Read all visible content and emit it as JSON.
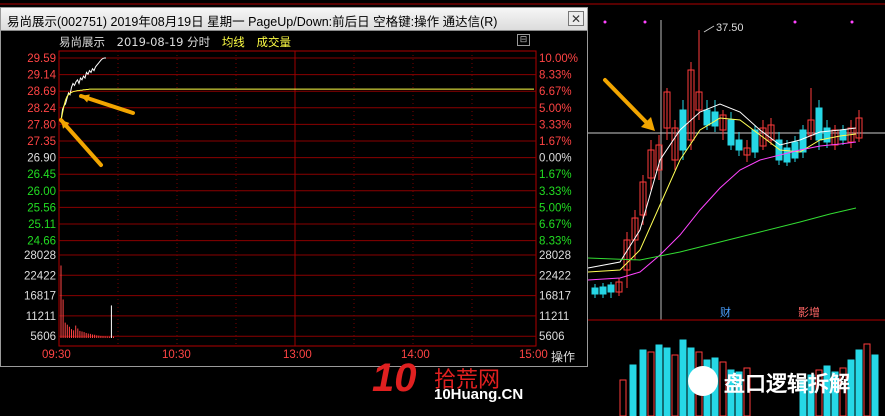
{
  "window": {
    "title": "易尚展示(002751)  2019年08月19日 星期一  PageUp/Down:前后日 空格键:操作  通达信(R)",
    "close_symbol": "✕",
    "minimize_symbol": "⊟"
  },
  "info_row": {
    "stock_name": "易尚展示",
    "date_label": "2019-08-19 分时",
    "avg_line_label": "均线",
    "volume_label": "成交量"
  },
  "price_axis": {
    "left": [
      "29.59",
      "29.14",
      "28.69",
      "28.24",
      "27.80",
      "27.35",
      "26.90",
      "26.45",
      "26.00",
      "25.56",
      "25.11",
      "24.66"
    ],
    "right": [
      "10.00%",
      "8.33%",
      "6.67%",
      "5.00%",
      "3.33%",
      "1.67%",
      "0.00%",
      "1.67%",
      "3.33%",
      "5.00%",
      "6.67%",
      "8.33%"
    ]
  },
  "volume_axis": {
    "left": [
      "28028",
      "22422",
      "16817",
      "11211",
      "5606"
    ],
    "right": [
      "28028",
      "22422",
      "16817",
      "11211",
      "5606"
    ]
  },
  "time_axis": [
    "09:30",
    "10:30",
    "13:00",
    "14:00",
    "15:00"
  ],
  "operate_button": "操作",
  "background_chart": {
    "high_label": "37.50",
    "badge_cai": "财",
    "badge_zeng": "影增",
    "colors": {
      "up": "#ff3b3b",
      "down": "#26d7e6",
      "ma1": "#ffffff",
      "ma2": "#ffff55",
      "ma3": "#ff44ff",
      "ma4": "#33dd33"
    }
  },
  "watermark": {
    "logo_number": "10",
    "site_cn": "拾荒网",
    "site_url": "10Huang.CN",
    "wechat_name": "盘口逻辑拆解"
  },
  "chart_data": {
    "type": "line",
    "title": "易尚展示 2019-08-19 分时",
    "x": [
      "09:30",
      "09:31",
      "09:32",
      "09:33",
      "09:34",
      "09:35",
      "09:36",
      "09:37",
      "09:38",
      "09:39",
      "09:40",
      "09:41",
      "09:42",
      "09:43",
      "09:44",
      "09:45",
      "09:46",
      "09:47",
      "09:48",
      "09:49",
      "09:50",
      "09:51",
      "09:52",
      "09:53",
      "09:54",
      "09:55",
      "09:56",
      "09:57",
      "09:58",
      "09:59",
      "10:00",
      "15:00"
    ],
    "series": [
      {
        "name": "price",
        "values": [
          27.9,
          28.2,
          28.3,
          28.35,
          28.5,
          28.65,
          28.6,
          28.8,
          28.9,
          28.85,
          28.95,
          29.0,
          28.9,
          29.05,
          29.0,
          29.1,
          29.05,
          29.2,
          29.15,
          29.25,
          29.2,
          29.3,
          29.25,
          29.35,
          29.4,
          29.45,
          29.5,
          29.55,
          29.58,
          29.59,
          29.59,
          29.59
        ]
      },
      {
        "name": "均线",
        "values": [
          27.9,
          28.1,
          28.3,
          28.45,
          28.55,
          28.6,
          28.64,
          28.66,
          28.68,
          28.69,
          28.7,
          28.71,
          28.71,
          28.72,
          28.72,
          28.73,
          28.73,
          28.74,
          28.74,
          28.75,
          28.75,
          28.75,
          28.75,
          28.75,
          28.75,
          28.75,
          28.75,
          28.75,
          28.75,
          28.75,
          28.75,
          28.75
        ]
      }
    ],
    "prev_close": 26.9,
    "ylim": [
      24.21,
      29.59
    ],
    "volume": {
      "name": "成交量",
      "x": [
        "09:30",
        "09:31",
        "09:32",
        "09:33",
        "09:34",
        "09:35",
        "09:36",
        "09:37",
        "09:38",
        "09:39",
        "09:40",
        "09:41",
        "09:42",
        "09:43",
        "09:44",
        "09:45",
        "09:46",
        "09:47",
        "09:48",
        "09:49",
        "09:50",
        "09:51",
        "09:52",
        "09:53",
        "09:54",
        "09:55"
      ],
      "values": [
        24500,
        13000,
        5200,
        4500,
        3800,
        3000,
        2600,
        4200,
        3200,
        2400,
        2200,
        2000,
        1700,
        1500,
        1400,
        1200,
        1100,
        900,
        800,
        700,
        650,
        600,
        550,
        500,
        11000,
        500
      ],
      "ylim": [
        0,
        28028
      ]
    }
  }
}
